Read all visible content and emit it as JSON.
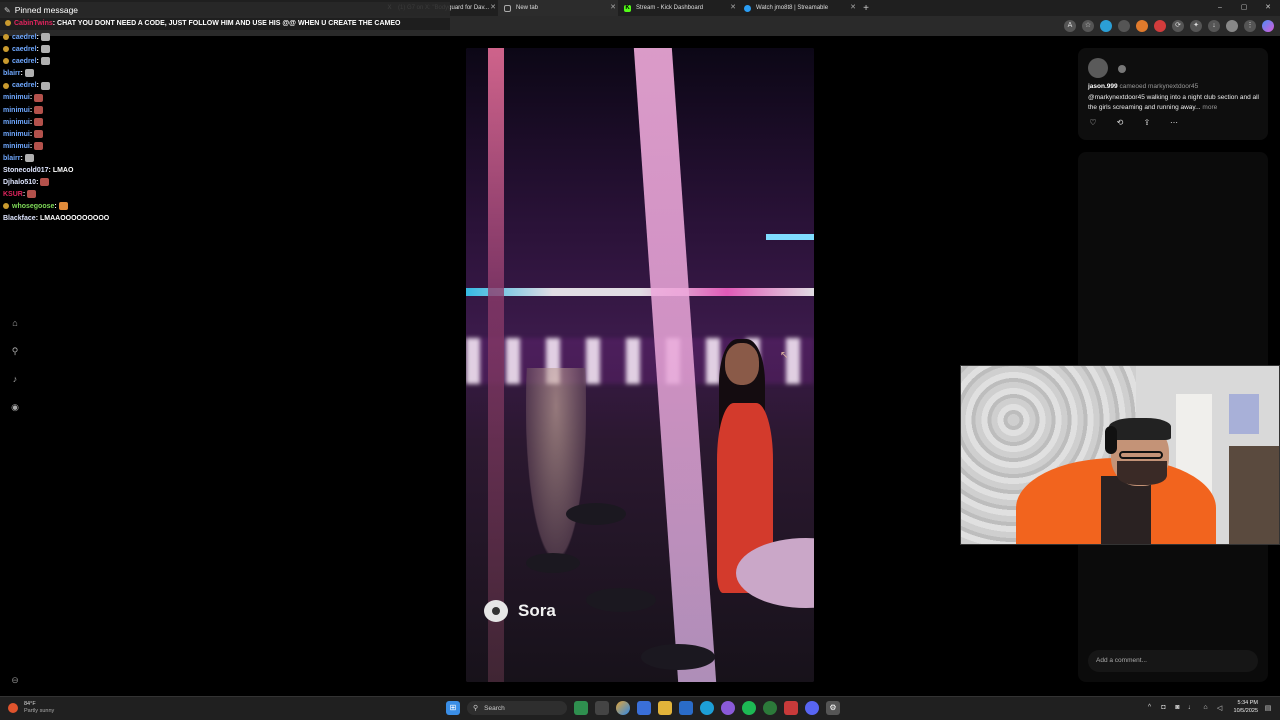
{
  "browser": {
    "tabs": [
      {
        "label": "(1) G7 on X: \"Bodyguard for Dav...",
        "fav": "X"
      },
      {
        "label": "New tab",
        "fav": ""
      },
      {
        "label": "Stream - Kick Dashboard",
        "fav": "K"
      },
      {
        "label": "Watch jmo8t8 | Streamable",
        "fav": ""
      }
    ],
    "new_tab": "+",
    "window_controls": [
      "–",
      "▢",
      "✕"
    ]
  },
  "chat": {
    "pinned_title": "Pinned message",
    "pinned_user": "CabinTwins",
    "pinned_text": ": CHAT YOU DONT NEED A CODE, JUST FOLLOW HIM AND USE HIS @@ WHEN U CREATE THE CAMEO",
    "messages": [
      {
        "user": "caedrel",
        "sep": ":",
        "text": "",
        "emote": "cat",
        "badge": true
      },
      {
        "user": "caedrel",
        "sep": ":",
        "text": "",
        "emote": "cat",
        "badge": true
      },
      {
        "user": "caedrel",
        "sep": ":",
        "text": "",
        "emote": "cat",
        "badge": true
      },
      {
        "user": "blairr",
        "sep": ":",
        "text": "",
        "emote": "cat",
        "badge": false
      },
      {
        "user": "caedrel",
        "sep": ":",
        "text": "",
        "emote": "cat",
        "badge": true
      },
      {
        "user": "minimui",
        "sep": ":",
        "text": "",
        "emote": "red",
        "badge": false
      },
      {
        "user": "minimui",
        "sep": ":",
        "text": "",
        "emote": "red",
        "badge": false
      },
      {
        "user": "minimui",
        "sep": ":",
        "text": "",
        "emote": "red",
        "badge": false
      },
      {
        "user": "minimui",
        "sep": ":",
        "text": "",
        "emote": "red",
        "badge": false
      },
      {
        "user": "minimui",
        "sep": ":",
        "text": "",
        "emote": "red",
        "badge": false
      },
      {
        "user": "blairr",
        "sep": ":",
        "text": "",
        "emote": "cat",
        "badge": false
      },
      {
        "user": "Stonecold017",
        "sep": ":",
        "text": "LMAO",
        "emote": "",
        "badge": false
      },
      {
        "user": "Djhalo510",
        "sep": ":",
        "text": "",
        "emote": "red",
        "badge": false
      },
      {
        "user": "KSUR",
        "sep": ":",
        "text": "",
        "emote": "red",
        "badge": false
      },
      {
        "user": "whosegoose",
        "sep": ":",
        "text": "",
        "emote": "or",
        "badge": true
      },
      {
        "user": "Blackface",
        "sep": ":",
        "text": "LMAAOOOOOOOOO",
        "emote": "",
        "badge": false
      }
    ]
  },
  "video": {
    "watermark": "Sora"
  },
  "post": {
    "username": "jason.999",
    "cameo_text": "cameoed markynextdoor45",
    "caption": "@markynextdoor45 walking into a night club section and all the girls screaming and running away...",
    "more": "more",
    "comment_placeholder": "Add a comment..."
  },
  "taskbar": {
    "weather_temp": "84°F",
    "weather_desc": "Partly sunny",
    "search_label": "Search",
    "time": "5:34 PM",
    "date": "10/5/2025"
  }
}
